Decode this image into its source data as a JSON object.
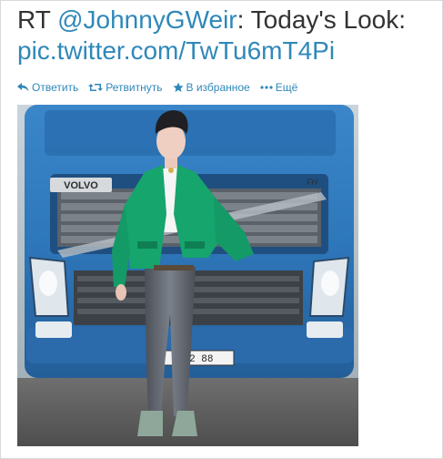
{
  "tweet": {
    "prefix": "RT ",
    "mention": "@JohnnyGWeir",
    "text_after_mention": ": Today's Look: ",
    "link": "pic.twitter.com/TwTu6mT4Pi"
  },
  "actions": {
    "reply": "Ответить",
    "retweet": "Ретвитнуть",
    "favorite": "В избранное",
    "more": "Ещё"
  },
  "photo": {
    "truck_brand": "VOLVO",
    "truck_model": "FH",
    "plate": "12 88"
  },
  "colors": {
    "link": "#2f88b9",
    "text": "#333333",
    "truck_blue": "#2f78bd",
    "jacket_green": "#16a56d"
  }
}
